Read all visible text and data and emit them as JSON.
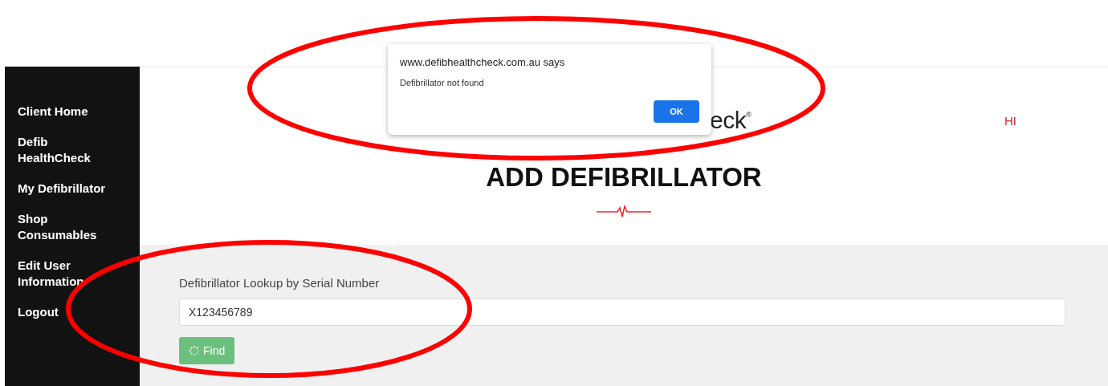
{
  "sidebar": {
    "items": [
      {
        "label": "Client Home"
      },
      {
        "label": "Defib\nHealthCheck"
      },
      {
        "label": "My Defibrillator"
      },
      {
        "label": "Shop\nConsumables"
      },
      {
        "label": "Edit User\nInformation"
      },
      {
        "label": "Logout"
      }
    ]
  },
  "header": {
    "logo_text": "eck$^{®}$",
    "greeting": "HI"
  },
  "page_title": "ADD DEFIBRILLATOR",
  "lookup": {
    "label": "Defibrillator Lookup by Serial Number",
    "value": "X123456789",
    "button": "Find",
    "loading": true
  },
  "dialog": {
    "title": "www.defibhealthcheck.com.au says",
    "message": "Defibrillator not found",
    "button": "OK"
  }
}
